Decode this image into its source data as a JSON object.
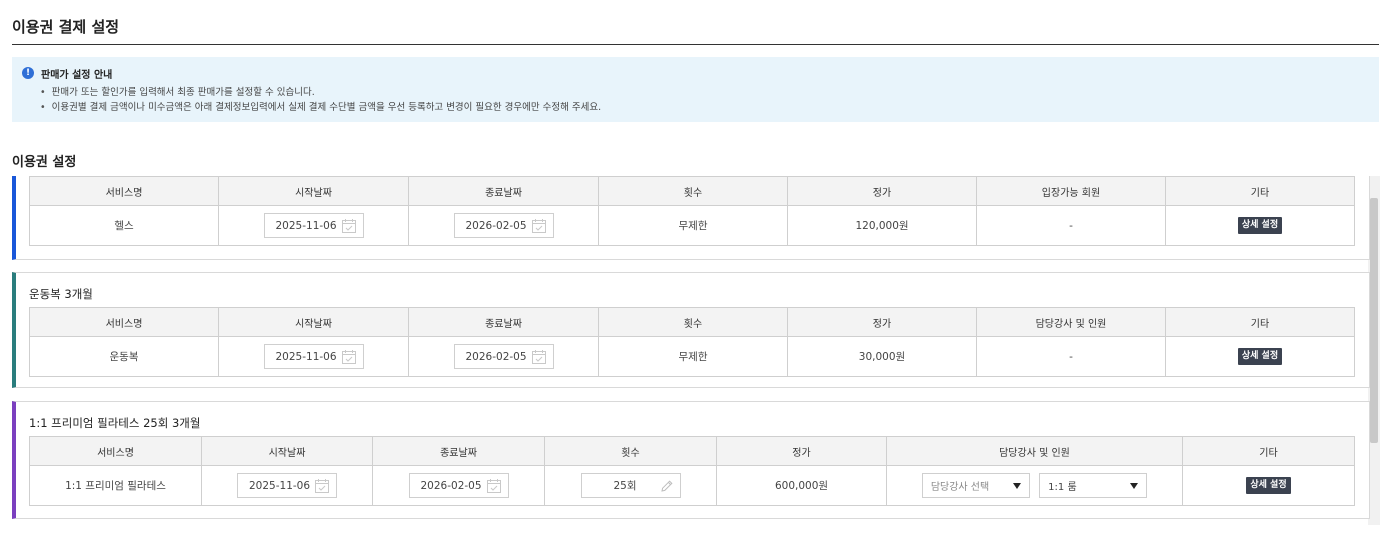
{
  "page": {
    "title": "이용권 결제 설정"
  },
  "notice": {
    "icon": "info-icon",
    "title": "판매가 설정 안내",
    "lines": [
      "판매가 또는 할인가를 입력해서 최종 판매가를 설정할 수 있습니다.",
      "이용권별 결제 금액이나 미수금액은 아래 결제정보입력에서 실제 결제 수단별 금액을 우선 등록하고 변경이 필요한 경우에만 수정해 주세요."
    ]
  },
  "section": {
    "title": "이용권 설정"
  },
  "cards": [
    {
      "name": "",
      "headers": [
        "서비스명",
        "시작날짜",
        "종료날짜",
        "횟수",
        "정가",
        "입장가능 회원",
        "기타"
      ],
      "row": {
        "service": "헬스",
        "start": "2025-11-06",
        "end": "2026-02-05",
        "count": "무제한",
        "price": "120,000원",
        "extra": "-",
        "button": "상세 설정"
      }
    },
    {
      "name": "운동복 3개월",
      "headers": [
        "서비스명",
        "시작날짜",
        "종료날짜",
        "횟수",
        "정가",
        "담당강사 및 인원",
        "기타"
      ],
      "row": {
        "service": "운동복",
        "start": "2025-11-06",
        "end": "2026-02-05",
        "count": "무제한",
        "price": "30,000원",
        "extra": "-",
        "button": "상세 설정"
      }
    },
    {
      "name": "1:1 프리미엄 필라테스 25회 3개월",
      "headers": [
        "서비스명",
        "시작날짜",
        "종료날짜",
        "횟수",
        "정가",
        "담당강사 및 인원",
        "기타"
      ],
      "row": {
        "service": "1:1 프리미엄 필라테스",
        "start": "2025-11-06",
        "end": "2026-02-05",
        "count": "25회",
        "price": "600,000원",
        "instructor_placeholder": "담당강사 선택",
        "capacity": "1:1 룸",
        "button": "상세 설정"
      }
    }
  ],
  "colors": {
    "accent_card1": "#1957d9",
    "accent_card2": "#2a7d7d",
    "accent_card3": "#7b3fbf",
    "notice_bg": "#e8f4fb"
  }
}
